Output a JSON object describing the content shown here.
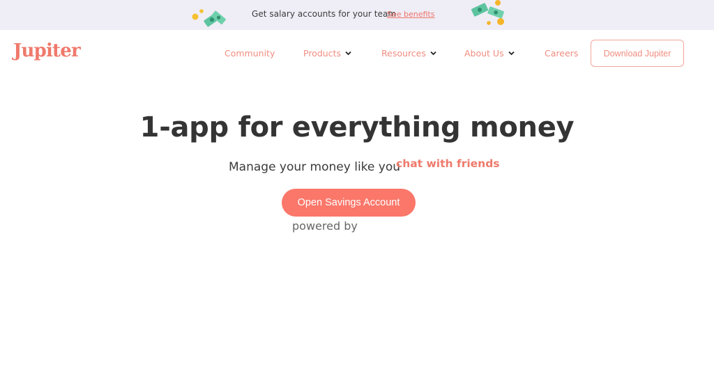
{
  "promo": {
    "text": "Get salary accounts for your team",
    "link": "See benefits",
    "left_icon": "money-coins-icon",
    "right_icon": "money-coins-icon"
  },
  "nav": {
    "logo": "Jupiter",
    "items": [
      {
        "label": "Community",
        "has_dropdown": false
      },
      {
        "label": "Products",
        "has_dropdown": true
      },
      {
        "label": "Resources",
        "has_dropdown": true
      },
      {
        "label": "About Us",
        "has_dropdown": true
      },
      {
        "label": "Careers",
        "has_dropdown": false
      }
    ],
    "download_label": "Download Jupiter"
  },
  "hero": {
    "title": "1-app for everything money",
    "subtitle": "Manage your money like you",
    "subtitle_accent": "chat with friends",
    "cta_label": "Open Savings Account",
    "powered_by": "powered by"
  },
  "colors": {
    "brand": "#ef7a6c",
    "cta": "#fa776a",
    "promo_bg": "#efedf6"
  }
}
